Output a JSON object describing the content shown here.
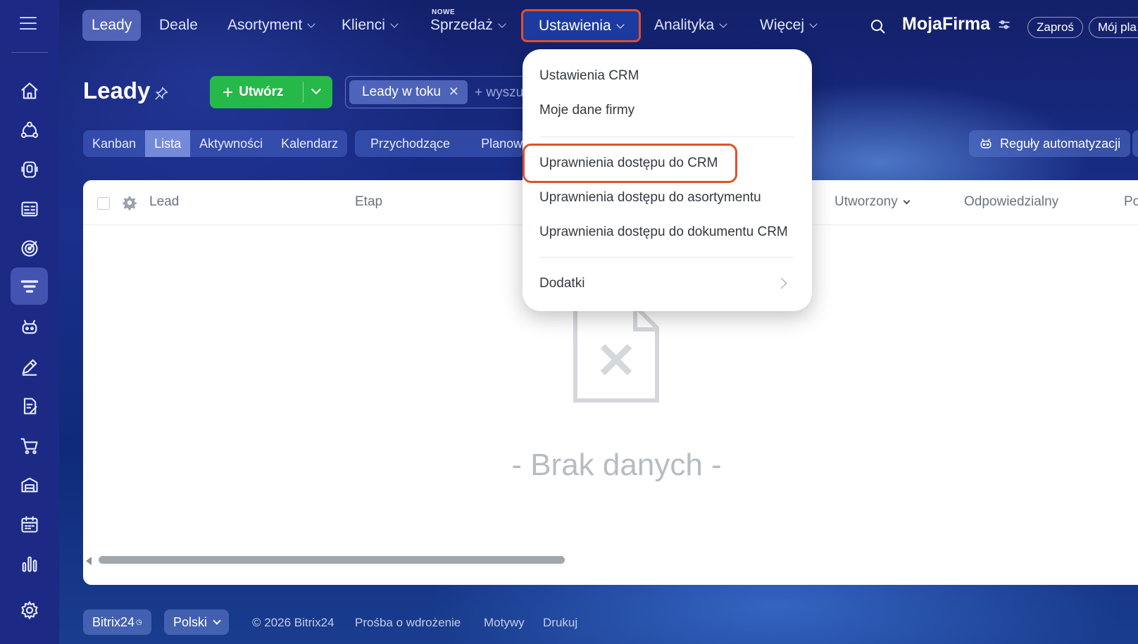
{
  "topnav": {
    "items": [
      {
        "label": "Leady"
      },
      {
        "label": "Deale"
      },
      {
        "label": "Asortyment"
      },
      {
        "label": "Klienci"
      },
      {
        "label": "Sprzedaż",
        "badge": "NOWE"
      },
      {
        "label": "Ustawienia"
      },
      {
        "label": "Analityka"
      },
      {
        "label": "Więcej"
      }
    ],
    "brand": "MojaFirma",
    "invite_label": "Zaproś",
    "plan_label": "Mój pla"
  },
  "page": {
    "title": "Leady",
    "create_label": "Utwórz",
    "filter_chip": "Leady w toku",
    "filter_add": "+ wyszu"
  },
  "view_tabs": [
    "Kanban",
    "Lista",
    "Aktywności",
    "Kalendarz"
  ],
  "counter_tabs": [
    "Przychodzące",
    "Planowane"
  ],
  "automation_label": "Reguły automatyzacji",
  "grid": {
    "columns": {
      "lead": "Lead",
      "stage": "Etap",
      "created": "Utworzony",
      "responsible": "Odpowiedzialny",
      "next": "Po"
    },
    "empty_text": "- Brak danych -"
  },
  "settings_menu": {
    "items": [
      "Ustawienia CRM",
      "Moje dane firmy",
      "Uprawnienia dostępu do CRM",
      "Uprawnienia dostępu do asortymentu",
      "Uprawnienia dostępu do dokumentu CRM",
      "Dodatki"
    ]
  },
  "footer": {
    "product": "Bitrix24",
    "language": "Polski",
    "copyright": "© 2026 Bitrix24",
    "links": [
      "Prośba o wdrożenie",
      "Motywy",
      "Drukuj"
    ]
  },
  "colors": {
    "highlight": "#e2502b",
    "create_button": "#27b84a",
    "rail": "#1c2a86"
  }
}
